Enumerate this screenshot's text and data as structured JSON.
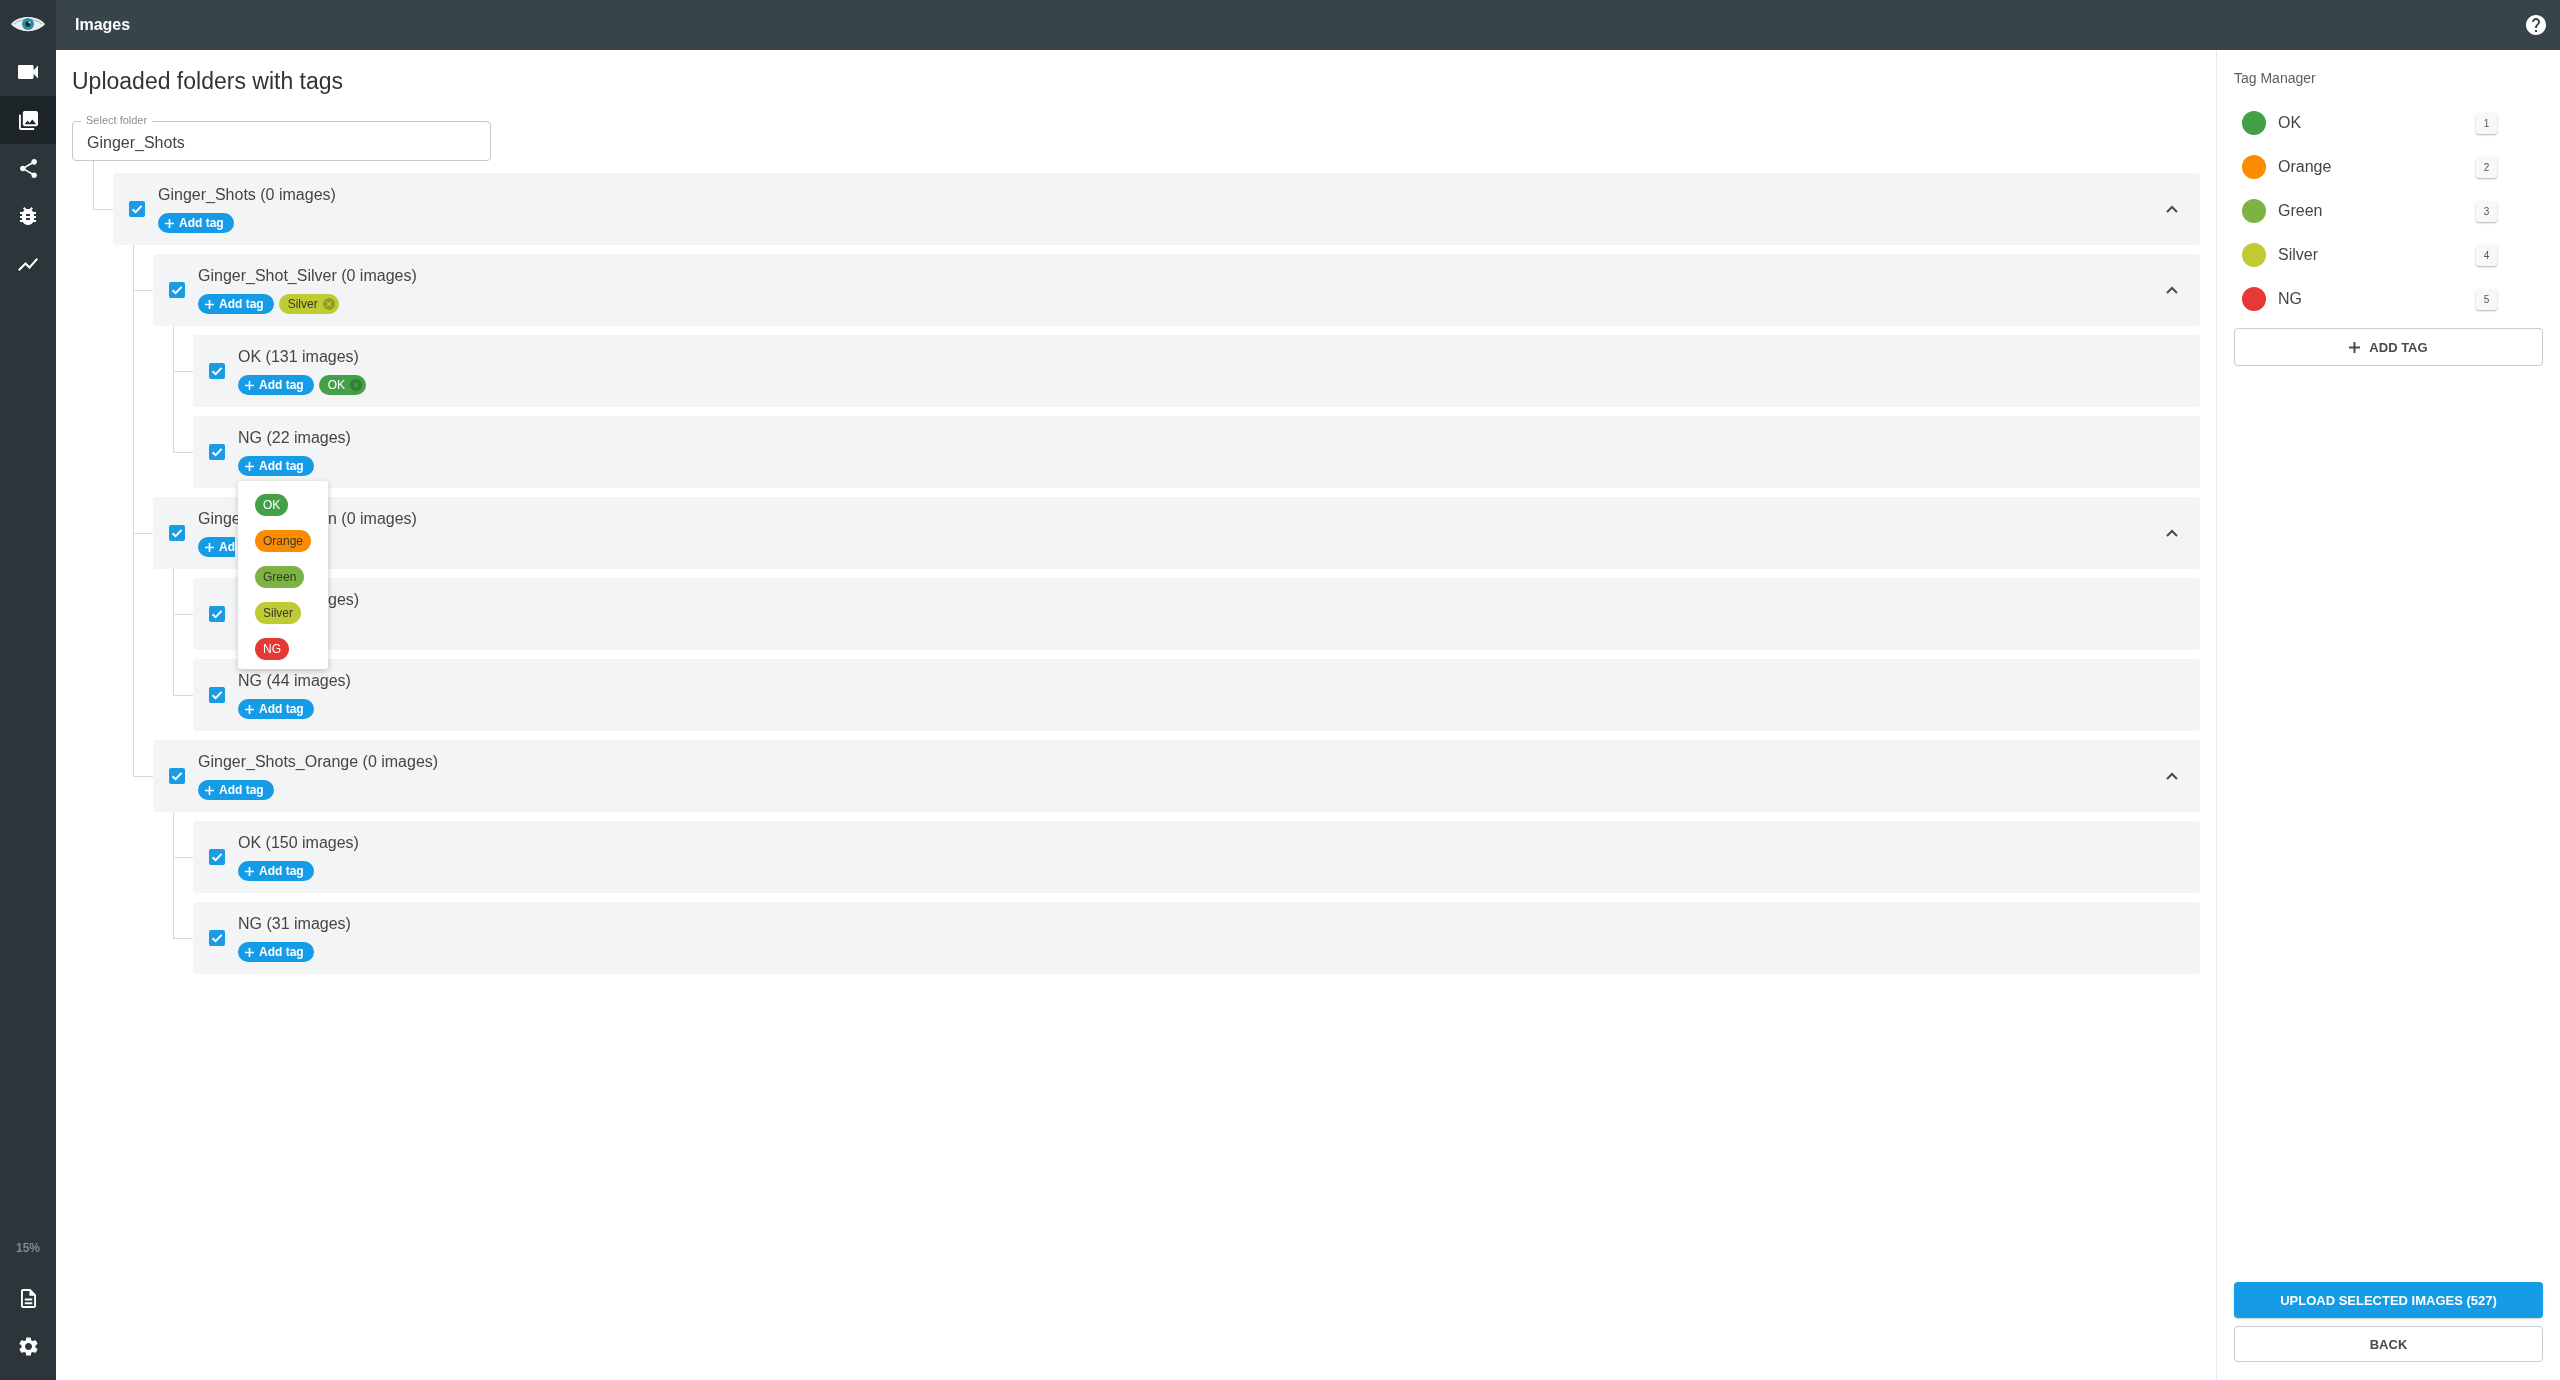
{
  "sidebar": {
    "nav_items": [
      {
        "kind": "camera",
        "selected": false
      },
      {
        "kind": "gallery",
        "selected": true
      },
      {
        "kind": "share",
        "selected": false
      },
      {
        "kind": "bug",
        "selected": false
      },
      {
        "kind": "chart",
        "selected": false
      }
    ],
    "usage": "15%",
    "bottom_items": [
      {
        "kind": "document"
      },
      {
        "kind": "settings"
      }
    ]
  },
  "header": {
    "title": "Images"
  },
  "main": {
    "title": "Uploaded folders with tags",
    "folder_select": {
      "label": "Select folder",
      "value": "Ginger_Shots"
    },
    "tree": [
      {
        "label": "Ginger_Shots (0 images)",
        "checked": true,
        "expanded": true,
        "add_tag": "Add tag",
        "children": [
          {
            "label": "Ginger_Shot_Silver (0 images)",
            "checked": true,
            "expanded": true,
            "add_tag": "Add tag",
            "tags": [
              {
                "label": "Silver",
                "color": "#c0ca33"
              }
            ],
            "children": [
              {
                "label": "OK (131 images)",
                "checked": true,
                "add_tag": "Add tag",
                "tags": [
                  {
                    "label": "OK",
                    "color": "#43a047"
                  }
                ]
              },
              {
                "label": "NG (22 images)",
                "checked": true,
                "add_tag": "Add tag",
                "tag_menu": [
                  {
                    "label": "OK",
                    "color": "#43a047"
                  },
                  {
                    "label": "Orange",
                    "color": "#fb8c00"
                  },
                  {
                    "label": "Green",
                    "color": "#7cb342"
                  },
                  {
                    "label": "Silver",
                    "color": "#c0ca33"
                  },
                  {
                    "label": "NG",
                    "color": "#e53935"
                  }
                ]
              }
            ]
          },
          {
            "partly_covered": true,
            "label_before": "Ginge",
            "label_after": "n (0 images)",
            "checked": true,
            "expanded": true,
            "add_tag": "Ad",
            "children": [
              {
                "partly_covered": true,
                "label_after": "ges)",
                "checked": true
              },
              {
                "label": "NG (44 images)",
                "checked": true,
                "add_tag": "Add tag"
              }
            ]
          },
          {
            "label": "Ginger_Shots_Orange (0 images)",
            "checked": true,
            "expanded": true,
            "add_tag": "Add tag",
            "children": [
              {
                "label": "OK (150 images)",
                "checked": true,
                "add_tag": "Add tag"
              },
              {
                "label": "NG (31 images)",
                "checked": true,
                "add_tag": "Add tag"
              }
            ]
          }
        ]
      }
    ]
  },
  "tag_manager": {
    "title": "Tag Manager",
    "tags": [
      {
        "label": "OK",
        "color": "#43a047",
        "shortcut": "1"
      },
      {
        "label": "Orange",
        "color": "#fb8c00",
        "shortcut": "2"
      },
      {
        "label": "Green",
        "color": "#7cb342",
        "shortcut": "3"
      },
      {
        "label": "Silver",
        "color": "#c0ca33",
        "shortcut": "4"
      },
      {
        "label": "NG",
        "color": "#e53935",
        "shortcut": "5"
      }
    ],
    "add_button": "ADD TAG"
  },
  "actions": {
    "upload": "UPLOAD SELECTED IMAGES (527)",
    "back": "BACK"
  }
}
